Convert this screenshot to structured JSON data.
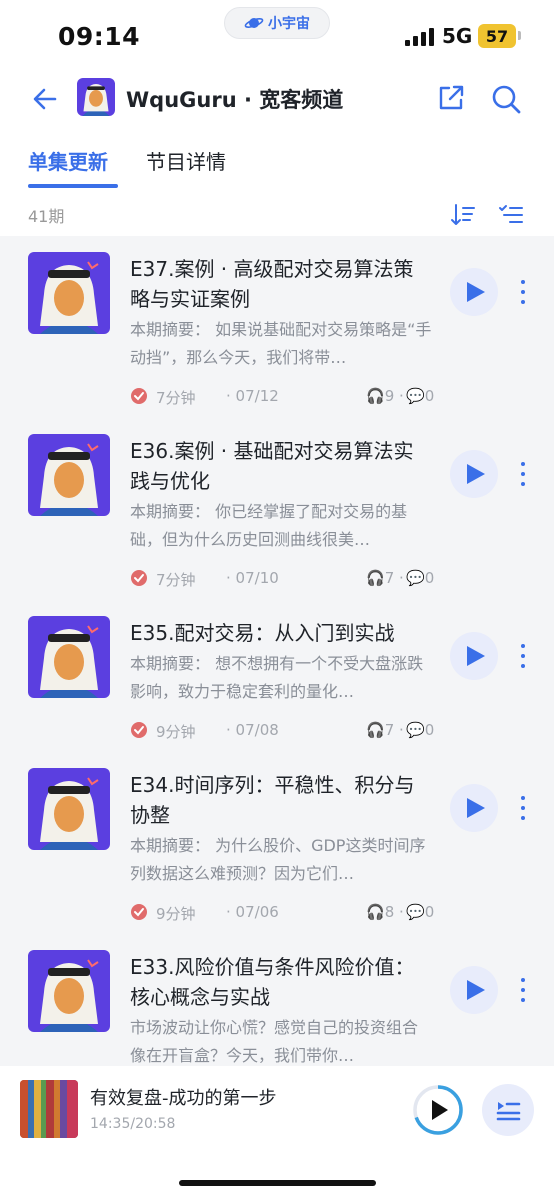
{
  "status_bar": {
    "time": "09:14",
    "app_name": "小宇宙",
    "network": "5G",
    "battery": "57"
  },
  "header": {
    "title": "WquGuru · 宽客频道"
  },
  "tabs": [
    {
      "label": "单集更新",
      "active": true
    },
    {
      "label": "节目详情",
      "active": false
    }
  ],
  "episode_count": "41期",
  "episodes": [
    {
      "title": "E37.案例 · 高级配对交易算法策略与实证案例",
      "summary": "本期摘要： 如果说基础配对交易策略是“手动挡”，那么今天，我们将带…",
      "duration": "7分钟",
      "date": "07/12",
      "listens": "9",
      "comments": "0"
    },
    {
      "title": "E36.案例 · 基础配对交易算法实践与优化",
      "summary": "本期摘要： 你已经掌握了配对交易的基础，但为什么历史回测曲线很美…",
      "duration": "7分钟",
      "date": "07/10",
      "listens": "7",
      "comments": "0"
    },
    {
      "title": "E35.配对交易：从入门到实战",
      "summary": "本期摘要： 想不想拥有一个不受大盘涨跌影响，致力于稳定套利的量化…",
      "duration": "9分钟",
      "date": "07/08",
      "listens": "7",
      "comments": "0"
    },
    {
      "title": "E34.时间序列：平稳性、积分与协整",
      "summary": "本期摘要： 为什么股价、GDP这类时间序列数据这么难预测？因为它们…",
      "duration": "9分钟",
      "date": "07/06",
      "listens": "8",
      "comments": "0"
    },
    {
      "title": "E33.风险价值与条件风险价值：核心概念与实战",
      "summary": "市场波动让你心慌？感觉自己的投资组合像在开盲盒？今天，我们带你…",
      "duration": "",
      "date": "",
      "listens": "",
      "comments": ""
    }
  ],
  "player": {
    "title": "有效复盘-成功的第一步",
    "time": "14:35/20:58",
    "progress": 0.696
  },
  "colors": {
    "accent": "#3a6fe8",
    "check": "#e06b6b",
    "cover_bg": "#5b3fe0"
  }
}
